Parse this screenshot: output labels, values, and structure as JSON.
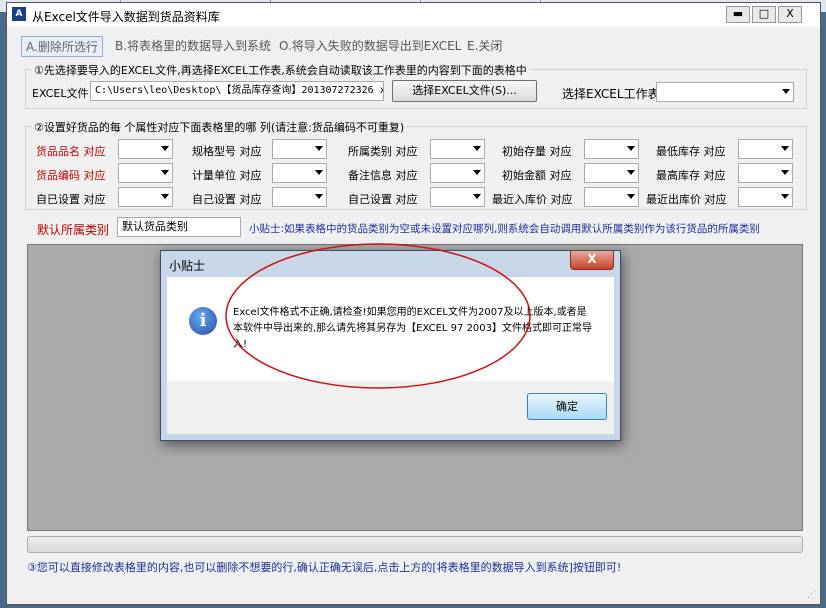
{
  "window": {
    "title": "从Excel文件导入数据到货品资料库",
    "minimize": "▬",
    "maximize": "□",
    "close": "X"
  },
  "menu": {
    "items": [
      {
        "label": "A.删除所选行"
      },
      {
        "label": "B.将表格里的数据导入到系统"
      },
      {
        "label": "O.将导入失败的数据导出到EXCEL"
      },
      {
        "label": "E.关闭"
      }
    ]
  },
  "step1": {
    "legend": "①先选择要导入的EXCEL文件,再选择EXCEL工作表,系统会自动读取该工作表里的内容到下面的表格中",
    "file_label": "EXCEL文件",
    "file_path": "C:\\Users\\leo\\Desktop\\【货品库存查询】201307272326 x:",
    "select_file_button": "选择EXCEL文件(S)...",
    "sheet_label": "选择EXCEL工作表"
  },
  "step2": {
    "legend": "②设置好货品的每  个属性对应下面表格里的哪  列(请注意:货品编码不可重复)",
    "fields": [
      {
        "label": "货品品名  对应",
        "required": true
      },
      {
        "label": "规格型号  对应",
        "required": false
      },
      {
        "label": "所属类别  对应",
        "required": false
      },
      {
        "label": "初始存量  对应",
        "required": false
      },
      {
        "label": "最低库存  对应",
        "required": false
      },
      {
        "label": "货品编码  对应",
        "required": true
      },
      {
        "label": "计量单位  对应",
        "required": false
      },
      {
        "label": "备注信息  对应",
        "required": false
      },
      {
        "label": "初始金额  对应",
        "required": false
      },
      {
        "label": "最高库存  对应",
        "required": false
      },
      {
        "label": "自已设置  对应",
        "required": false
      },
      {
        "label": "自己设置  对应",
        "required": false
      },
      {
        "label": "自己设置  对应",
        "required": false
      },
      {
        "label": "最近入库价  对应",
        "required": false
      },
      {
        "label": "最近出库价  对应",
        "required": false
      }
    ]
  },
  "default_category": {
    "label": "默认所属类别",
    "value": "默认货品类别",
    "tip": "小贴士:如果表格中的货品类别为空或未设置对应哪列,则系统会自动调用默认所属类别作为该行货品的所属类别"
  },
  "footer": {
    "text": "③您可以直接修改表格里的内容,也可以删除不想要的行,确认正确无误后,点击上方的[将表格里的数据导入到系统]按钮即可!"
  },
  "dialog": {
    "title": "小贴士",
    "close": "X",
    "icon": "info-icon",
    "message": "Excel文件格式不正确,请检查!如果您用的EXCEL文件为2007及以上版本,或者是本软件中导出来的,那么请先将其另存为【EXCEL 97 2003】文件格式即可正常导入!",
    "ok_button": "确定"
  },
  "colors": {
    "required_label": "#c00000",
    "tip_text": "#1a2fa0",
    "annotation_ellipse": "#d01010"
  }
}
